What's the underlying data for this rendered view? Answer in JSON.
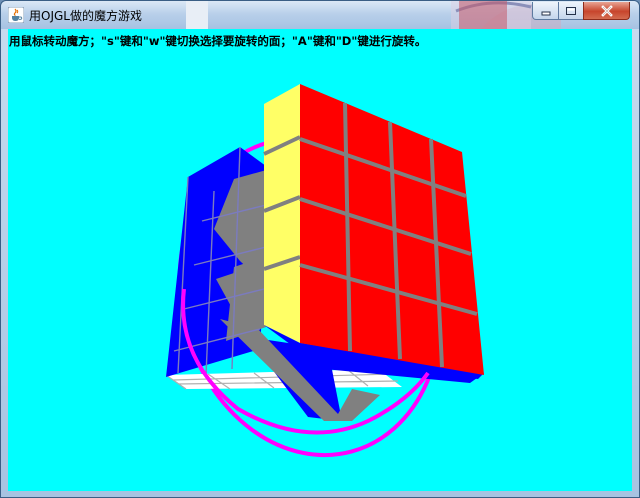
{
  "window": {
    "title": "用OJGL做的魔方游戏",
    "icon": "java-cup-icon",
    "controls": {
      "minimize_icon": "minimize-icon",
      "maximize_icon": "maximize-icon",
      "close_icon": "close-icon"
    }
  },
  "canvas": {
    "background": "#00ffff",
    "instructions": "用鼠标转动魔方；\"s\"键和\"w\"键切换选择要旋转的面；\"A\"键和\"D\"键进行旋转。"
  },
  "cube": {
    "size": "4x4",
    "face_colors": {
      "front": "#ff0000",
      "left": "#ffff66",
      "back": "#0000ff",
      "bottom": "#ffffff",
      "gap": "#808080"
    },
    "selection_ring_color": "#ff00ff"
  }
}
